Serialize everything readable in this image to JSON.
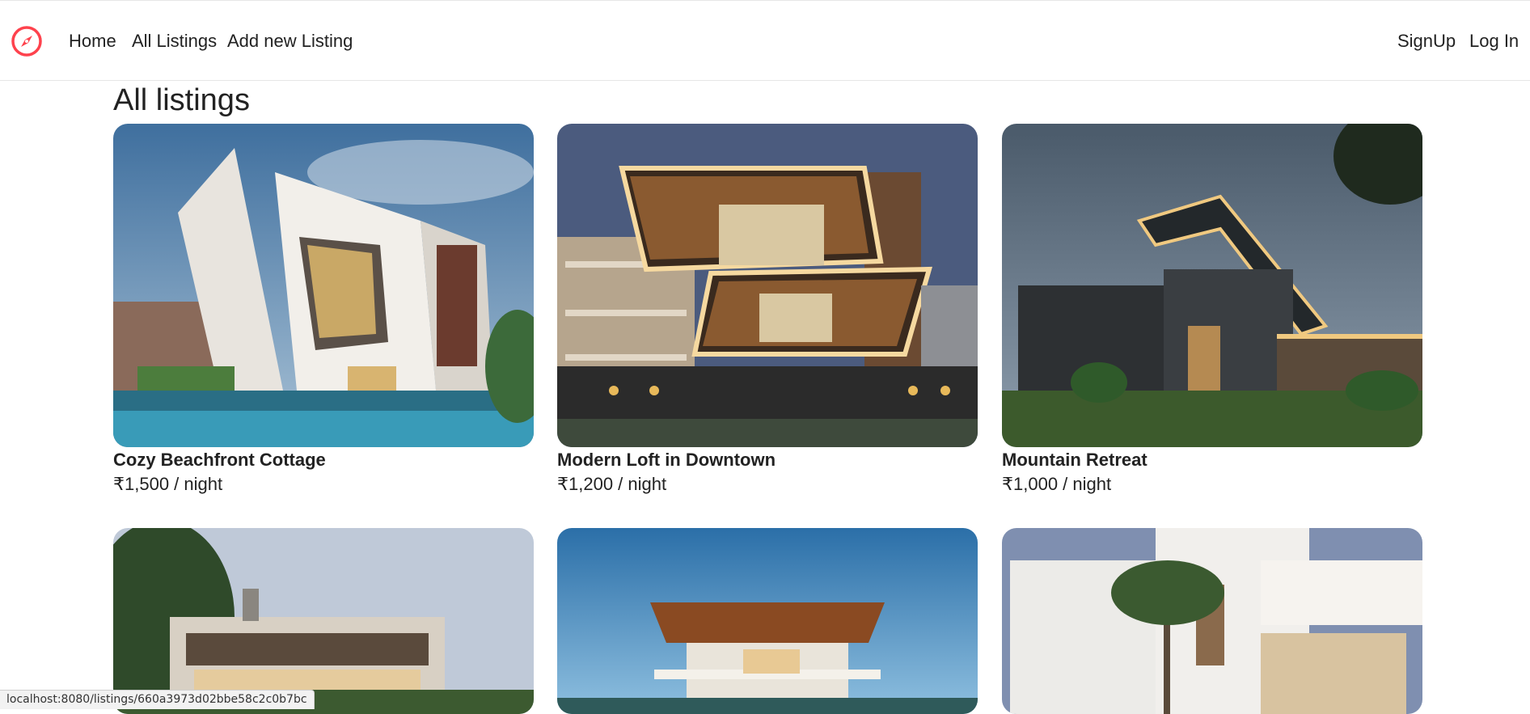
{
  "nav": {
    "links": [
      "Home",
      "All Listings",
      "Add new Listing"
    ],
    "signup": "SignUp",
    "login": "Log In",
    "accent": "#fe424d"
  },
  "page": {
    "title": "All listings"
  },
  "listings": [
    {
      "title": "Cozy Beachfront Cottage",
      "price": "₹1,500 / night"
    },
    {
      "title": "Modern Loft in Downtown",
      "price": "₹1,200 / night"
    },
    {
      "title": "Mountain Retreat",
      "price": "₹1,000 / night"
    },
    {
      "title": "",
      "price": ""
    },
    {
      "title": "",
      "price": ""
    },
    {
      "title": "",
      "price": ""
    }
  ],
  "status": {
    "url": "localhost:8080/listings/660a3973d02bbe58c2c0b7bc"
  }
}
